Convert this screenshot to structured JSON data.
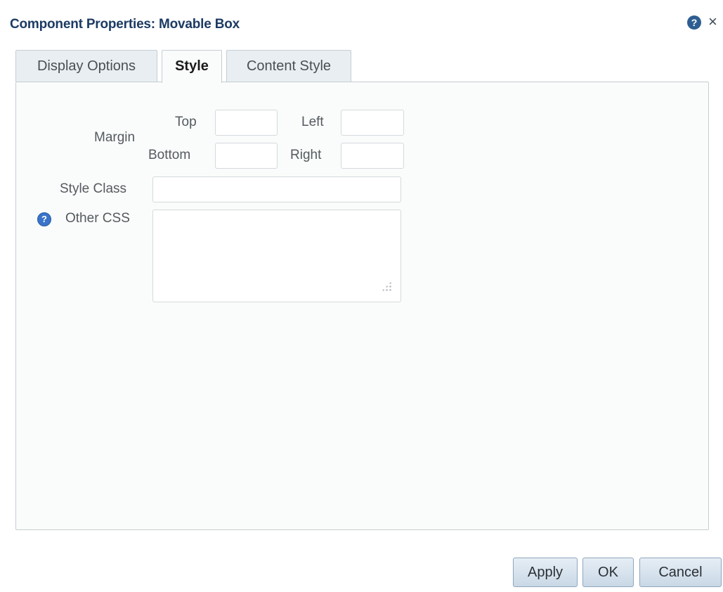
{
  "dialog": {
    "title": "Component Properties: Movable Box",
    "help_icon": "help-icon",
    "close_label": "×"
  },
  "tabs": [
    {
      "label": "Display Options",
      "active": false
    },
    {
      "label": "Style",
      "active": true
    },
    {
      "label": "Content Style",
      "active": false
    }
  ],
  "style_form": {
    "margin_label": "Margin",
    "top_label": "Top",
    "left_label": "Left",
    "bottom_label": "Bottom",
    "right_label": "Right",
    "top_value": "",
    "left_value": "",
    "bottom_value": "",
    "right_value": "",
    "style_class_label": "Style Class",
    "style_class_value": "",
    "other_css_label": "Other CSS",
    "other_css_value": "",
    "other_css_help_icon": "question-circle-icon"
  },
  "buttons": {
    "apply": "Apply",
    "ok": "OK",
    "cancel": "Cancel"
  },
  "colors": {
    "title": "#1c3b63",
    "panel_bg": "#f9fcfa",
    "border": "#c6cdd4",
    "button_border": "#8fa6bd"
  }
}
